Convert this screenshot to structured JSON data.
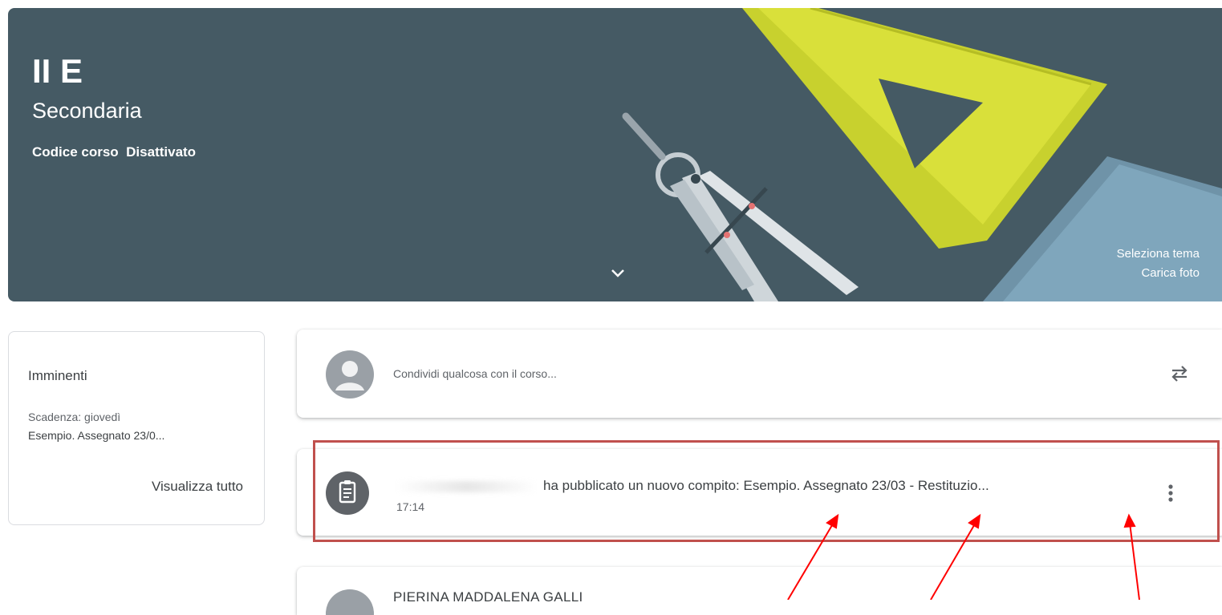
{
  "banner": {
    "title": "II E",
    "section": "Secondaria",
    "code_label": "Codice corso",
    "code_value": "Disattivato",
    "select_theme": "Seleziona tema",
    "upload_photo": "Carica foto",
    "background_color": "#455a64"
  },
  "upcoming": {
    "title": "Imminenti",
    "due": "Scadenza: giovedì",
    "item": "Esempio. Assegnato 23/0...",
    "view_all": "Visualizza tutto"
  },
  "share": {
    "placeholder": "Condividi qualcosa con il corso..."
  },
  "post": {
    "text": "ha pubblicato un nuovo compito: Esempio. Assegnato 23/03 - Restituzio...",
    "time": "17:14"
  },
  "next_post": {
    "author": "PIERINA MADDALENA GALLI"
  },
  "annotation": {
    "box_color": "#c0504d",
    "arrow_color": "#ff0000"
  },
  "icons": {
    "expand": "chevron-down-icon",
    "repost": "repost-icon",
    "assignment": "assignment-icon",
    "more": "more-vert-icon"
  }
}
